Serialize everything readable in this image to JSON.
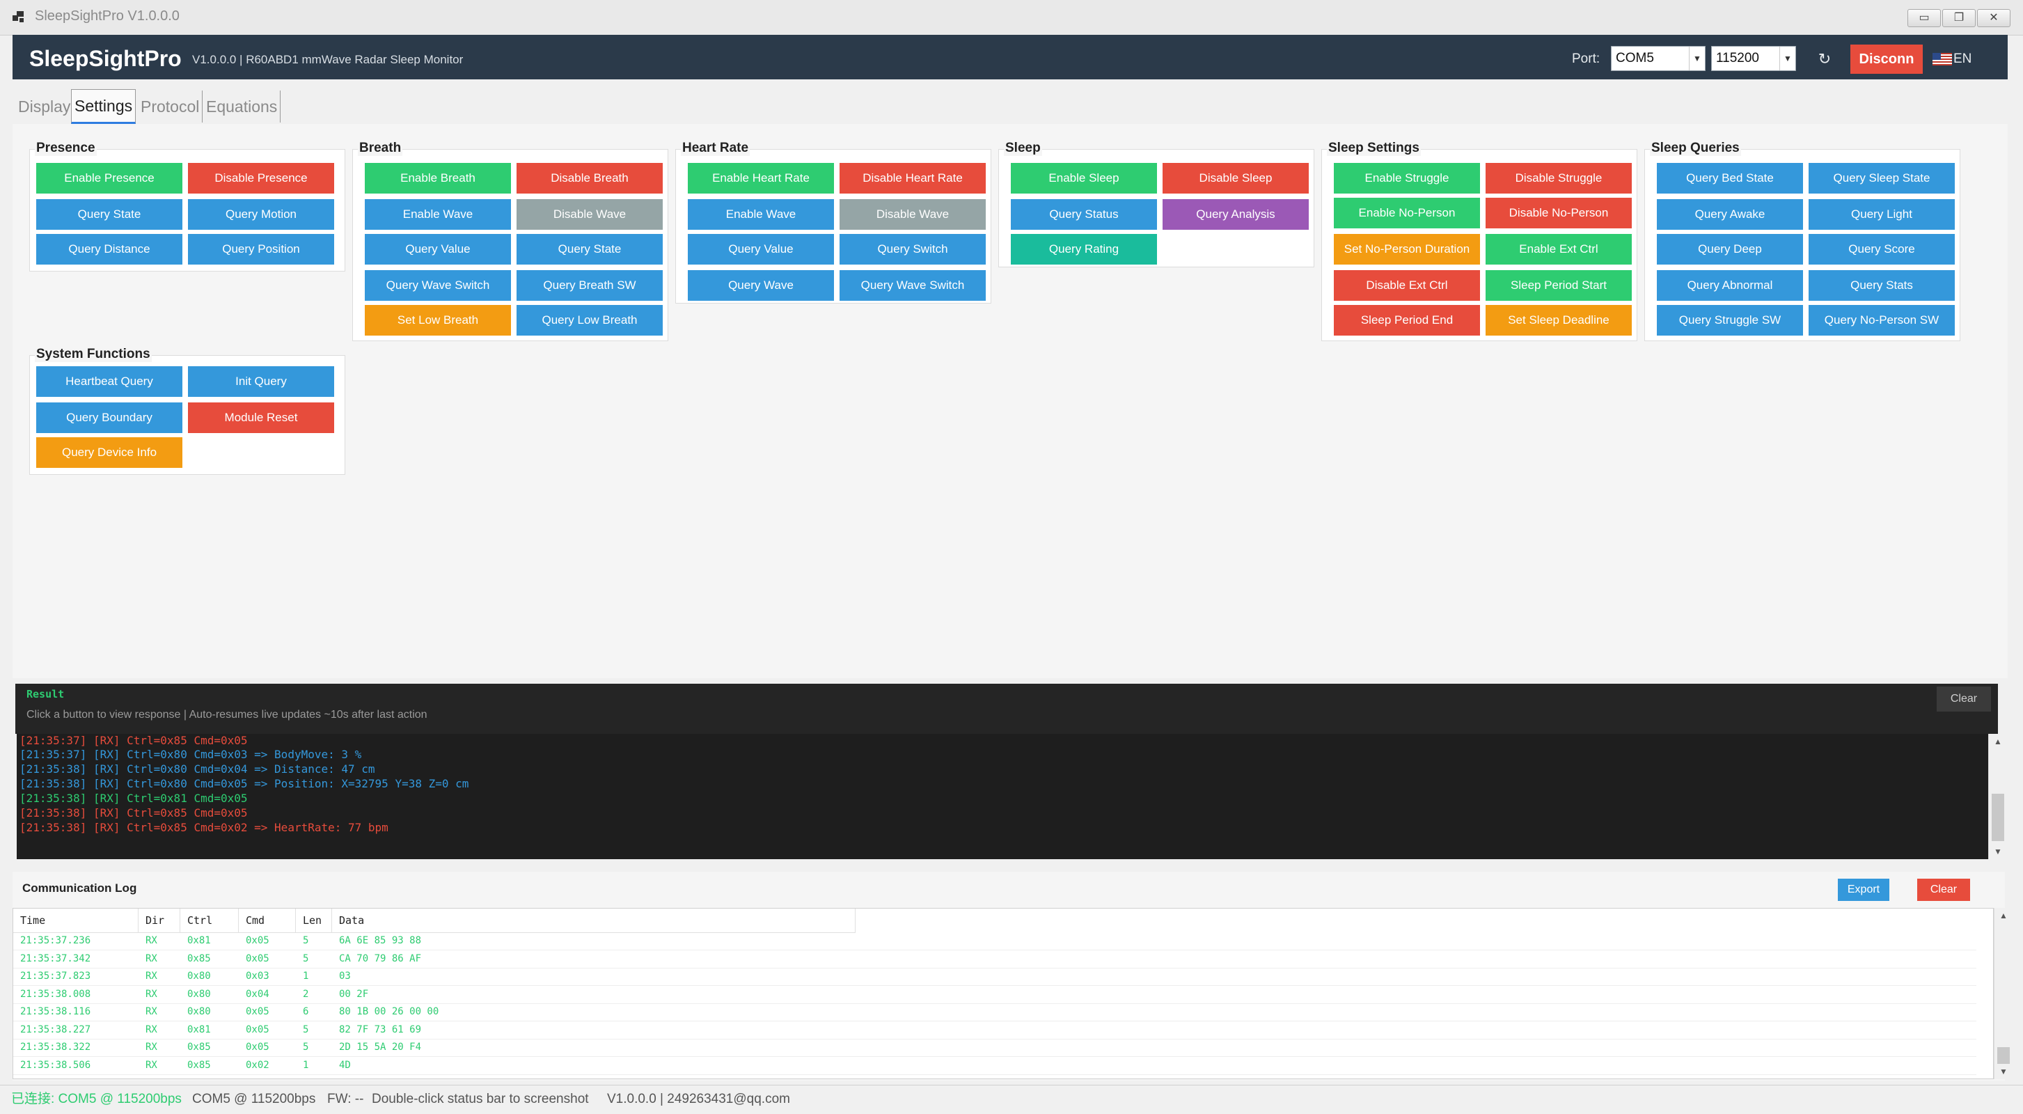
{
  "window": {
    "title": "SleepSightPro V1.0.0.0",
    "controls": [
      "minimize",
      "restore",
      "close"
    ]
  },
  "header": {
    "brand": "SleepSightPro",
    "subtitle": "V1.0.0.0 | R60ABD1 mmWave Radar Sleep Monitor",
    "port_label": "Port:",
    "port_value": "COM5",
    "baud_value": "115200",
    "refresh_icon": "↻",
    "disconnect_label": "Disconn",
    "language": "EN"
  },
  "tabs": [
    {
      "label": "Display",
      "active": false
    },
    {
      "label": "Settings",
      "active": true
    },
    {
      "label": "Protocol",
      "active": false
    },
    {
      "label": "Equations",
      "active": false
    }
  ],
  "groups": [
    {
      "title": "Presence",
      "buttons": [
        {
          "label": "Enable Presence",
          "color": "green"
        },
        {
          "label": "Disable Presence",
          "color": "red"
        },
        {
          "label": "Query State",
          "color": "blue"
        },
        {
          "label": "Query Motion",
          "color": "blue"
        },
        {
          "label": "Query Distance",
          "color": "blue"
        },
        {
          "label": "Query Position",
          "color": "blue"
        }
      ]
    },
    {
      "title": "Breath",
      "buttons": [
        {
          "label": "Enable Breath",
          "color": "green"
        },
        {
          "label": "Disable Breath",
          "color": "red"
        },
        {
          "label": "Enable Wave",
          "color": "blue"
        },
        {
          "label": "Disable Wave",
          "color": "gray"
        },
        {
          "label": "Query Value",
          "color": "blue"
        },
        {
          "label": "Query State",
          "color": "blue"
        },
        {
          "label": "Query Wave Switch",
          "color": "blue"
        },
        {
          "label": "Query Breath SW",
          "color": "blue"
        },
        {
          "label": "Set Low Breath",
          "color": "orange"
        },
        {
          "label": "Query Low Breath",
          "color": "blue"
        }
      ]
    },
    {
      "title": "Heart Rate",
      "buttons": [
        {
          "label": "Enable Heart Rate",
          "color": "green"
        },
        {
          "label": "Disable Heart Rate",
          "color": "red"
        },
        {
          "label": "Enable Wave",
          "color": "blue"
        },
        {
          "label": "Disable Wave",
          "color": "gray"
        },
        {
          "label": "Query Value",
          "color": "blue"
        },
        {
          "label": "Query Switch",
          "color": "blue"
        },
        {
          "label": "Query Wave",
          "color": "blue"
        },
        {
          "label": "Query Wave Switch",
          "color": "blue"
        }
      ]
    },
    {
      "title": "Sleep",
      "buttons": [
        {
          "label": "Enable Sleep",
          "color": "green"
        },
        {
          "label": "Disable Sleep",
          "color": "red"
        },
        {
          "label": "Query Status",
          "color": "blue"
        },
        {
          "label": "Query Analysis",
          "color": "purple"
        },
        {
          "label": "Query Rating",
          "color": "teal"
        }
      ]
    },
    {
      "title": "Sleep Settings",
      "buttons": [
        {
          "label": "Enable Struggle",
          "color": "green"
        },
        {
          "label": "Disable Struggle",
          "color": "red"
        },
        {
          "label": "Enable No-Person",
          "color": "green"
        },
        {
          "label": "Disable No-Person",
          "color": "red"
        },
        {
          "label": "Set No-Person Duration",
          "color": "orange"
        },
        {
          "label": "Enable Ext Ctrl",
          "color": "green"
        },
        {
          "label": "Disable Ext Ctrl",
          "color": "red"
        },
        {
          "label": "Sleep Period Start",
          "color": "green"
        },
        {
          "label": "Sleep Period End",
          "color": "red"
        },
        {
          "label": "Set Sleep Deadline",
          "color": "orange"
        }
      ]
    },
    {
      "title": "Sleep Queries",
      "buttons": [
        {
          "label": "Query Bed State",
          "color": "blue"
        },
        {
          "label": "Query Sleep State",
          "color": "blue"
        },
        {
          "label": "Query Awake",
          "color": "blue"
        },
        {
          "label": "Query Light",
          "color": "blue"
        },
        {
          "label": "Query Deep",
          "color": "blue"
        },
        {
          "label": "Query Score",
          "color": "blue"
        },
        {
          "label": "Query Abnormal",
          "color": "blue"
        },
        {
          "label": "Query Stats",
          "color": "blue"
        },
        {
          "label": "Query Struggle SW",
          "color": "blue"
        },
        {
          "label": "Query No-Person SW",
          "color": "blue"
        }
      ]
    },
    {
      "title": "System Functions",
      "buttons": [
        {
          "label": "Heartbeat Query",
          "color": "blue"
        },
        {
          "label": "Init Query",
          "color": "blue"
        },
        {
          "label": "Query Boundary",
          "color": "blue"
        },
        {
          "label": "Module Reset",
          "color": "red"
        },
        {
          "label": "Query Device Info",
          "color": "orange"
        }
      ]
    }
  ],
  "result": {
    "title": "Result",
    "subtitle": "Click a button to view response | Auto-resumes live updates ~10s after last action",
    "clear_label": "Clear",
    "lines": [
      {
        "text": "[21:35:37] [RX] Ctrl=0x85 Cmd=0x05",
        "color": "red"
      },
      {
        "text": "[21:35:37] [RX] Ctrl=0x80 Cmd=0x03 => BodyMove: 3 %",
        "color": "blue"
      },
      {
        "text": "[21:35:38] [RX] Ctrl=0x80 Cmd=0x04 => Distance: 47 cm",
        "color": "blue"
      },
      {
        "text": "[21:35:38] [RX] Ctrl=0x80 Cmd=0x05 => Position: X=32795 Y=38 Z=0 cm",
        "color": "blue"
      },
      {
        "text": "[21:35:38] [RX] Ctrl=0x81 Cmd=0x05",
        "color": "green"
      },
      {
        "text": "[21:35:38] [RX] Ctrl=0x85 Cmd=0x05",
        "color": "red"
      },
      {
        "text": "[21:35:38] [RX] Ctrl=0x85 Cmd=0x02 => HeartRate: 77 bpm",
        "color": "red"
      }
    ]
  },
  "comm_log": {
    "title": "Communication Log",
    "export_label": "Export",
    "clear_label": "Clear",
    "columns": [
      "Time",
      "Dir",
      "Ctrl",
      "Cmd",
      "Len",
      "Data"
    ],
    "rows": [
      [
        "21:35:37.236",
        "RX",
        "0x81",
        "0x05",
        "5",
        "6A 6E 85 93 88"
      ],
      [
        "21:35:37.342",
        "RX",
        "0x85",
        "0x05",
        "5",
        "CA 70 79 86 AF"
      ],
      [
        "21:35:37.823",
        "RX",
        "0x80",
        "0x03",
        "1",
        "03"
      ],
      [
        "21:35:38.008",
        "RX",
        "0x80",
        "0x04",
        "2",
        "00 2F"
      ],
      [
        "21:35:38.116",
        "RX",
        "0x80",
        "0x05",
        "6",
        "80 1B 00 26 00 00"
      ],
      [
        "21:35:38.227",
        "RX",
        "0x81",
        "0x05",
        "5",
        "82 7F 73 61 69"
      ],
      [
        "21:35:38.322",
        "RX",
        "0x85",
        "0x05",
        "5",
        "2D 15 5A 20 F4"
      ],
      [
        "21:35:38.506",
        "RX",
        "0x85",
        "0x02",
        "1",
        "4D"
      ]
    ]
  },
  "status_bar": {
    "connected": "已连接: COM5 @ 115200bps",
    "port_info": "COM5 @ 115200bps",
    "fw": "FW: --",
    "hint": "Double-click status bar to screenshot",
    "version": "V1.0.0.0 | 249263431@qq.com"
  },
  "colors": {
    "header_bg": "#2b3a4a",
    "green": "#2ecc71",
    "red": "#e74c3c",
    "blue": "#3498db",
    "gray": "#95a5a6",
    "orange": "#f39c12",
    "purple": "#9b59b6",
    "teal": "#1abc9c",
    "console_bg": "#1e1e1e"
  }
}
